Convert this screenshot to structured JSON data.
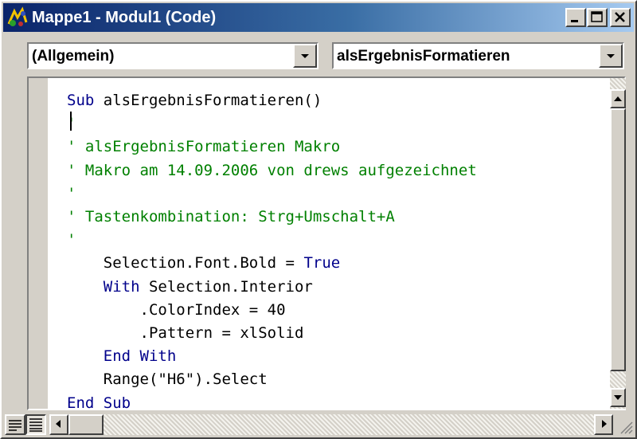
{
  "window": {
    "title": "Mappe1 - Modul1 (Code)",
    "icon": "vba-project-icon"
  },
  "titlebar_buttons": {
    "minimize": "minimize-icon",
    "maximize": "maximize-icon",
    "close": "close-icon"
  },
  "object_combo": {
    "value": "(Allgemein)"
  },
  "procedure_combo": {
    "value": "alsErgebnisFormatieren"
  },
  "code": {
    "lines": [
      {
        "indent": "",
        "parts": [
          {
            "text": "Sub",
            "kind": "keyword"
          },
          {
            "text": " alsErgebnisFormatieren()",
            "kind": "normal"
          }
        ]
      },
      {
        "indent": "",
        "parts": [
          {
            "text": "'",
            "kind": "comment"
          }
        ]
      },
      {
        "indent": "",
        "parts": [
          {
            "text": "' alsErgebnisFormatieren Makro",
            "kind": "comment"
          }
        ]
      },
      {
        "indent": "",
        "parts": [
          {
            "text": "' Makro am 14.09.2006 von drews aufgezeichnet",
            "kind": "comment"
          }
        ]
      },
      {
        "indent": "",
        "parts": [
          {
            "text": "'",
            "kind": "comment"
          }
        ]
      },
      {
        "indent": "",
        "parts": [
          {
            "text": "' Tastenkombination: Strg+Umschalt+A",
            "kind": "comment"
          }
        ]
      },
      {
        "indent": "",
        "parts": [
          {
            "text": "'",
            "kind": "comment"
          }
        ]
      },
      {
        "indent": "    ",
        "parts": [
          {
            "text": "Selection.Font.Bold = ",
            "kind": "normal"
          },
          {
            "text": "True",
            "kind": "keyword"
          }
        ]
      },
      {
        "indent": "    ",
        "parts": [
          {
            "text": "With",
            "kind": "keyword"
          },
          {
            "text": " Selection.Interior",
            "kind": "normal"
          }
        ]
      },
      {
        "indent": "        ",
        "parts": [
          {
            "text": ".ColorIndex = 40",
            "kind": "normal"
          }
        ]
      },
      {
        "indent": "        ",
        "parts": [
          {
            "text": ".Pattern = xlSolid",
            "kind": "normal"
          }
        ]
      },
      {
        "indent": "    ",
        "parts": [
          {
            "text": "End With",
            "kind": "keyword"
          }
        ]
      },
      {
        "indent": "    ",
        "parts": [
          {
            "text": "Range(\"H6\").Select",
            "kind": "normal"
          }
        ]
      },
      {
        "indent": "",
        "parts": [
          {
            "text": "End Sub",
            "kind": "keyword"
          }
        ]
      }
    ]
  },
  "colors": {
    "keyword": "#00008b",
    "comment": "#008000",
    "titlebar_start": "#0a246a",
    "titlebar_end": "#a6caf0"
  },
  "bottom_bar": {
    "procedure_view": "procedure-view-icon",
    "full_module_view": "full-module-view-icon"
  }
}
